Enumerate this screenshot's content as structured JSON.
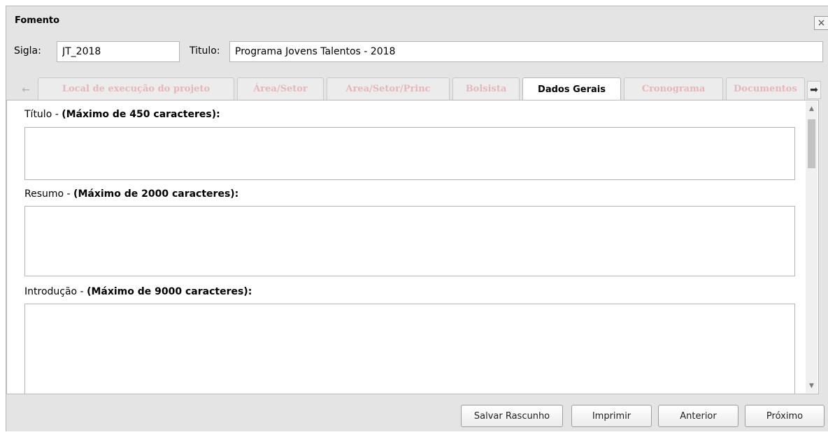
{
  "window": {
    "title": "Fomento",
    "close_glyph": "×",
    "close_icon": "close-icon"
  },
  "fields": {
    "sigla_label": "Sigla:",
    "sigla_value": "JT_2018",
    "titulo_label": "Titulo:",
    "titulo_value": "Programa Jovens Talentos - 2018"
  },
  "tabs": {
    "prev_glyph": "←",
    "next_glyph": "➡",
    "items": [
      {
        "label": "Local de execução do projeto",
        "active": false
      },
      {
        "label": "Área/Setor",
        "active": false
      },
      {
        "label": "Area/Setor/Princ",
        "active": false
      },
      {
        "label": "Bolsista",
        "active": false
      },
      {
        "label": "Dados Gerais",
        "active": true
      },
      {
        "label": "Cronograma",
        "active": false
      },
      {
        "label": "Documentos",
        "active": false
      }
    ]
  },
  "sections": [
    {
      "name": "Título",
      "separator": " - ",
      "limit": "(Máximo de 450 caracteres):"
    },
    {
      "name": "Resumo",
      "separator": " - ",
      "limit": "(Máximo de 2000 caracteres):"
    },
    {
      "name": "Introdução",
      "separator": " - ",
      "limit": "(Máximo de 9000 caracteres):"
    }
  ],
  "scrollbar": {
    "up_glyph": "▲",
    "down_glyph": "▼"
  },
  "footer": {
    "save_draft": "Salvar Rascunho",
    "print": "Imprimir",
    "previous": "Anterior",
    "next": "Próximo"
  },
  "colors": {
    "window_bg": "#e4e4e4",
    "disabled_tab_text": "#e4b8b8",
    "active_tab_text": "#000000"
  }
}
